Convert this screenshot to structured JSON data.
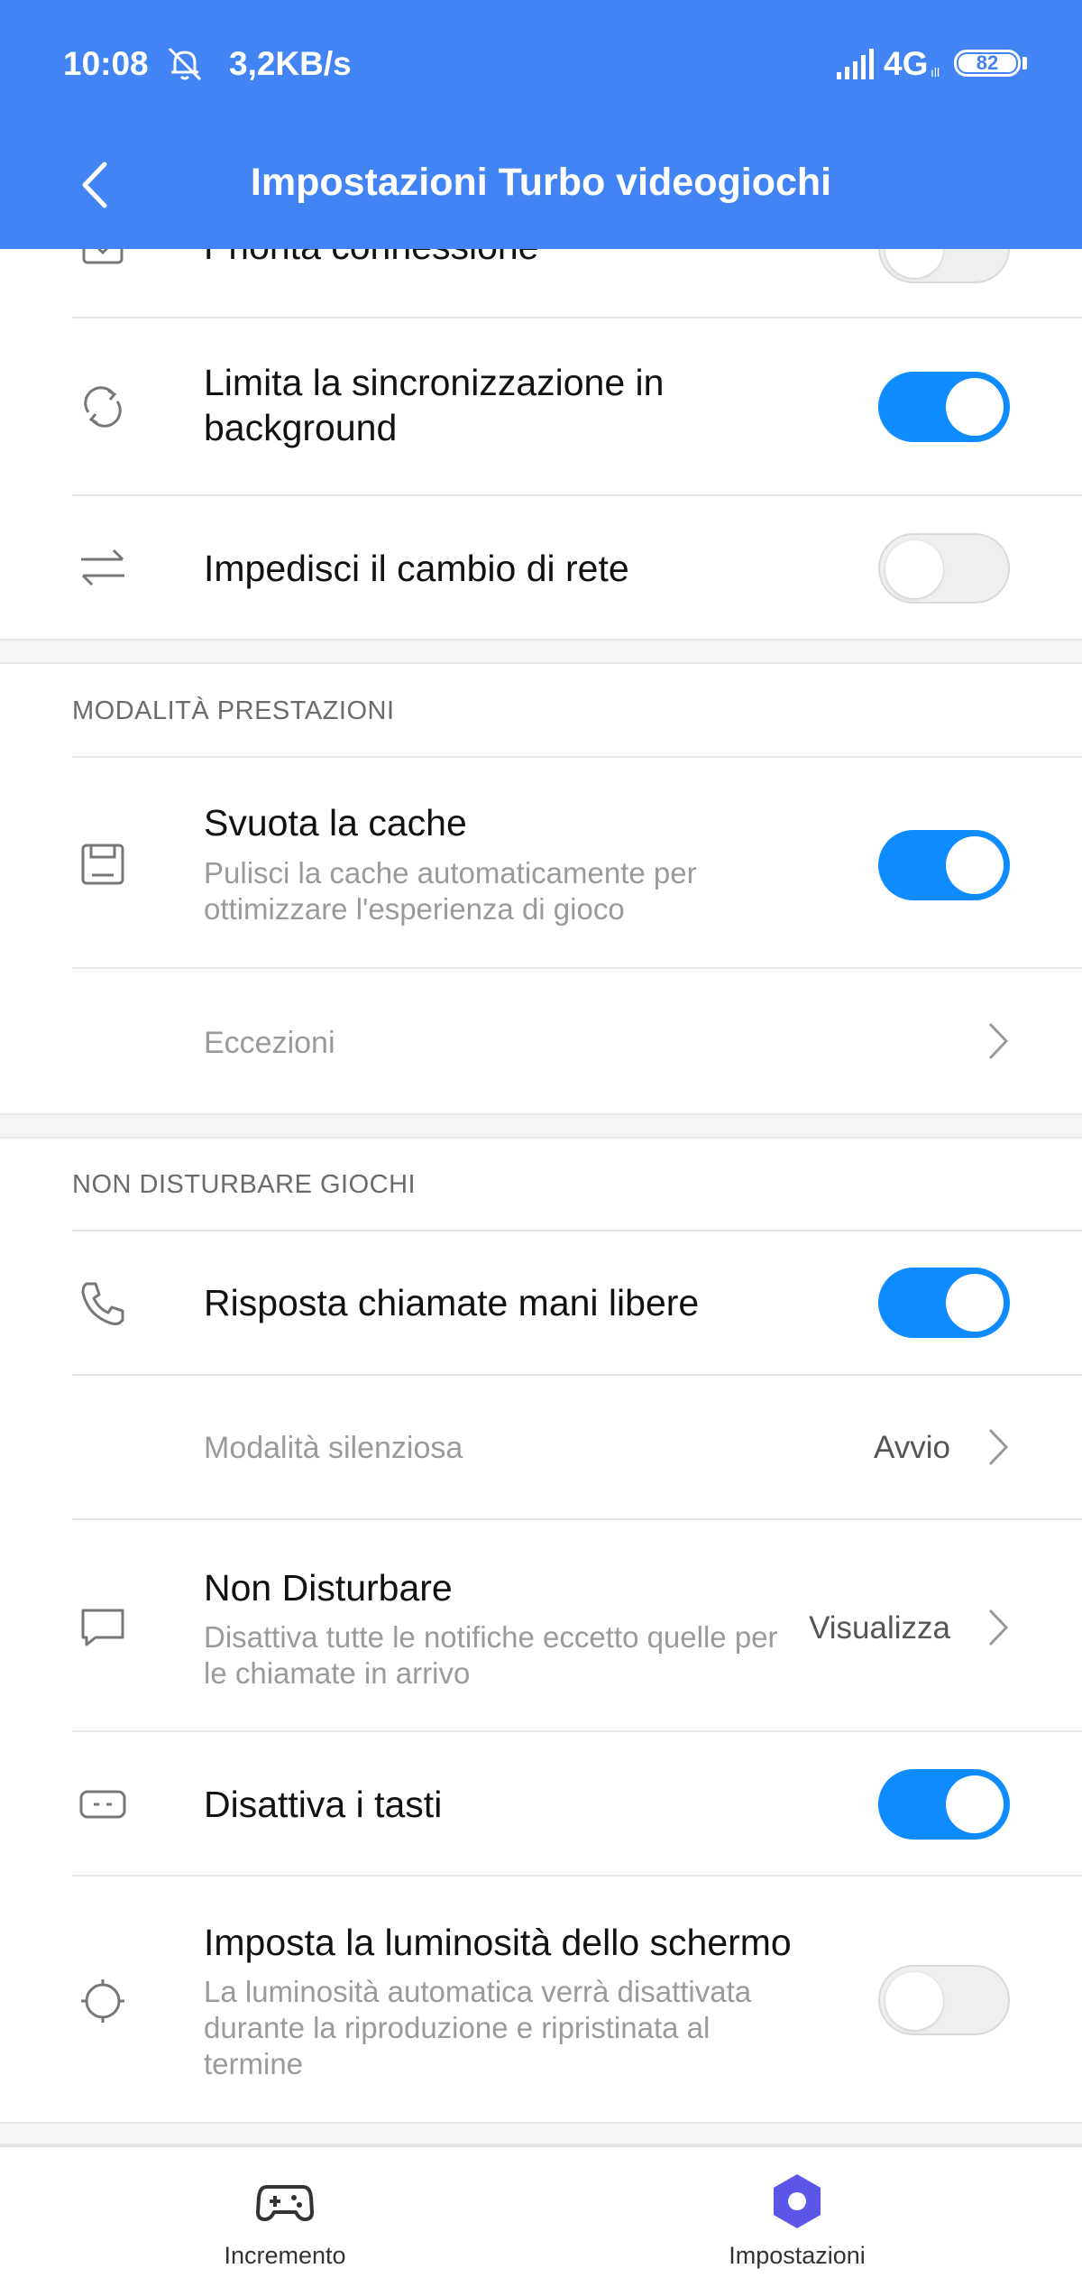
{
  "status_bar": {
    "time": "10:08",
    "speed": "3,2KB/s",
    "network": "4G",
    "network_sub": "ıll",
    "battery": "82"
  },
  "header": {
    "title": "Impostazioni Turbo videogiochi"
  },
  "network_section": {
    "partial_item": {
      "title": "Priorità connessione",
      "enabled": false
    },
    "items": [
      {
        "title": "Limita la sincronizzazione in background",
        "enabled": true
      },
      {
        "title": "Impedisci il cambio di rete",
        "enabled": false
      }
    ]
  },
  "performance_section": {
    "heading": "MODALITÀ PRESTAZIONI",
    "clear_cache": {
      "title": "Svuota la cache",
      "subtitle": "Pulisci la cache automaticamente per ottimizzare l'esperienza di gioco",
      "enabled": true
    },
    "exceptions_label": "Eccezioni"
  },
  "dnd_section": {
    "heading": "NON DISTURBARE GIOCHI",
    "handsfree": {
      "title": "Risposta chiamate mani libere",
      "enabled": true
    },
    "silent_mode": {
      "title": "Modalità silenziosa",
      "value": "Avvio"
    },
    "do_not_disturb": {
      "title": "Non Disturbare",
      "subtitle": "Disattiva tutte le notifiche eccetto quelle per le chiamate in arrivo",
      "value": "Visualizza"
    },
    "disable_keys": {
      "title": "Disattiva i tasti",
      "enabled": true
    },
    "brightness": {
      "title": "Imposta la luminosità dello schermo",
      "subtitle": "La luminosità automatica verrà disattivata durante la riproduzione e ripristinata al termine",
      "enabled": false
    }
  },
  "bottom_nav": {
    "items": [
      {
        "label": "Incremento",
        "active": false
      },
      {
        "label": "Impostazioni",
        "active": true
      }
    ]
  },
  "colors": {
    "header_bg": "#4284f3",
    "toggle_on": "#0d8bff",
    "active_nav": "#5b55e8"
  }
}
